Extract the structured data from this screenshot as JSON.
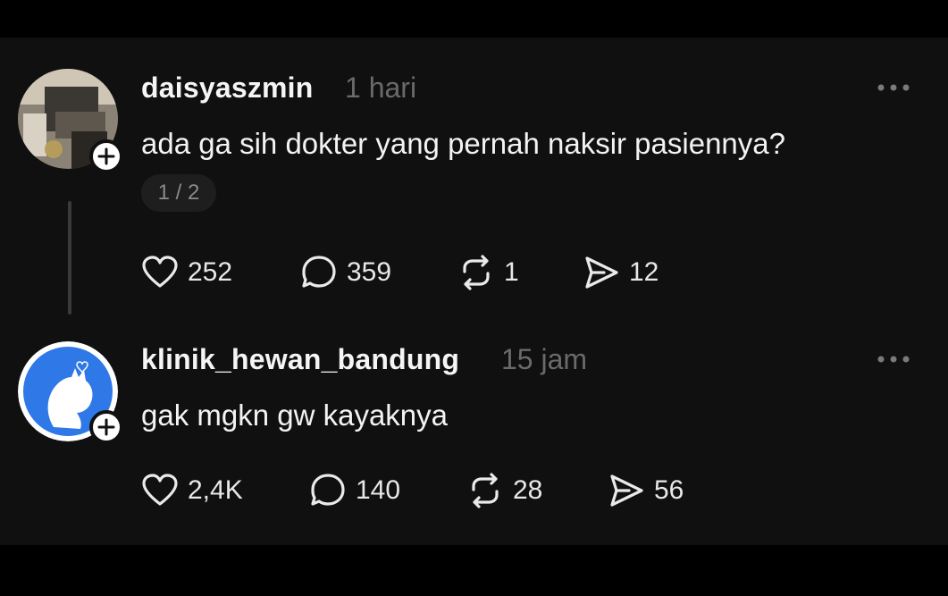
{
  "posts": [
    {
      "username": "daisyaszmin",
      "time": "1 hari",
      "text": "ada ga sih dokter yang pernah naksir pasiennya?",
      "page_indicator": "1 / 2",
      "stats": {
        "likes": "252",
        "replies": "359",
        "reposts": "1",
        "shares": "12"
      }
    },
    {
      "username": "klinik_hewan_bandung",
      "time": "15 jam",
      "text": "gak mgkn gw kayaknya",
      "stats": {
        "likes": "2,4K",
        "replies": "140",
        "reposts": "28",
        "shares": "56"
      }
    }
  ],
  "colors": {
    "background": "#101010",
    "muted": "#6a6a6a",
    "avatar_blue": "#2f78e8"
  },
  "icons": [
    "plus-icon",
    "more-icon",
    "heart-icon",
    "comment-icon",
    "repost-icon",
    "share-icon"
  ]
}
